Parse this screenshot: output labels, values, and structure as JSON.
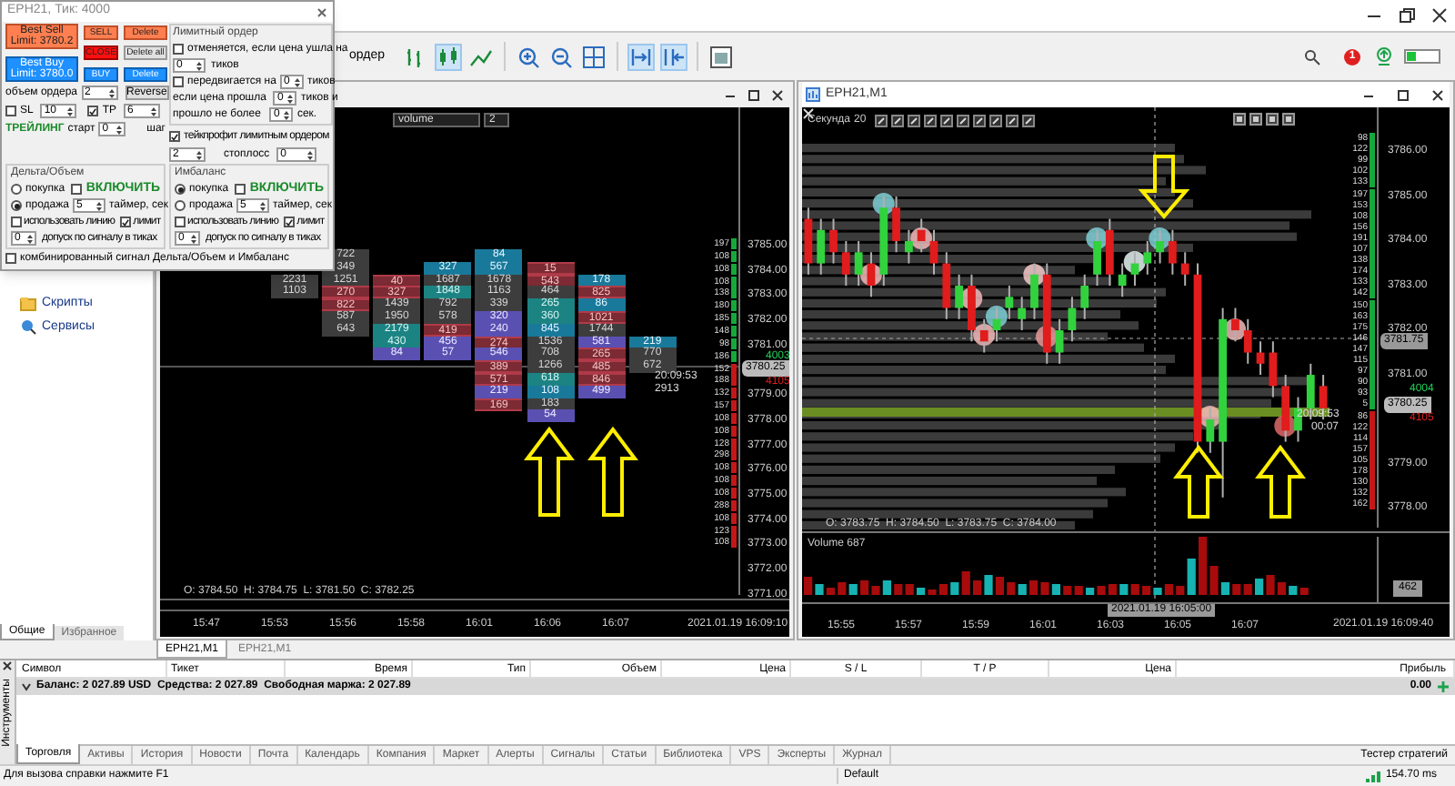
{
  "toolbar": {
    "partial_label": "ордер",
    "notification": "1"
  },
  "dialog": {
    "title": "EPH21, Тик: 4000",
    "big_buttons": [
      {
        "lines": [
          "Best Sell",
          "Limit: 3780.2"
        ],
        "kind": "sell"
      },
      {
        "lines": [
          "Best Buy",
          "Limit: 3780.0"
        ],
        "kind": "buy"
      }
    ],
    "small_buttons": [
      {
        "label": "SELL",
        "kind": "sell"
      },
      {
        "label": "Delete",
        "kind": "sell"
      },
      {
        "label": "CLOSE",
        "kind": "close"
      },
      {
        "label": "Delete all",
        "kind": "plain"
      },
      {
        "label": "BUY",
        "kind": "buy"
      },
      {
        "label": "Delete",
        "kind": "buy"
      }
    ],
    "volume": {
      "label": "объем ордера",
      "value": "2"
    },
    "reverse": "Reverse",
    "sl": {
      "label": "SL",
      "checked": false,
      "value": "10"
    },
    "tp": {
      "label": "TP",
      "checked": true,
      "value": "6"
    },
    "trailing": {
      "title": "ТРЕЙЛИНГ",
      "start_label": "старт",
      "start": "0",
      "step_label": "шаг",
      "step": "2",
      "stop_label": "стоплосс",
      "stop": "0"
    },
    "limit_order": {
      "title": "Лимитный ордер",
      "cancel": {
        "checked": false,
        "label": "отменяется, если цена ушла на",
        "value": "0",
        "unit": "тиков"
      },
      "move": {
        "checked": false,
        "label": "передвигается на",
        "value": "0",
        "unit": "тиков"
      },
      "if_passed": {
        "label": "если цена прошла",
        "value": "0",
        "unit": "тиков и"
      },
      "elapsed": {
        "label": "прошло не более",
        "value": "0",
        "unit": "сек."
      },
      "take_profit": {
        "checked": true,
        "label": "тейкпрофит лимитным ордером"
      }
    },
    "groups": [
      {
        "title": "Дельта/Объем",
        "buy": {
          "label": "покупка",
          "selected": false
        },
        "sell": {
          "label": "продажа",
          "selected": true
        },
        "enable": {
          "label": "ВКЛЮЧИТЬ",
          "checked": false
        },
        "timer": {
          "value": "5",
          "label": "таймер, сек"
        },
        "use_line": {
          "label": "использовать линию",
          "checked": false
        },
        "limit": {
          "label": "лимит",
          "checked": true
        },
        "tolerance": {
          "value": "0",
          "label": "допуск по сигналу в тиках"
        }
      },
      {
        "title": "Имбаланс",
        "buy": {
          "label": "покупка",
          "selected": true
        },
        "sell": {
          "label": "продажа",
          "selected": false
        },
        "enable": {
          "label": "ВКЛЮЧИТЬ",
          "checked": false
        },
        "timer": {
          "value": "5",
          "label": "таймер, сек"
        },
        "use_line": {
          "label": "использовать линию",
          "checked": false
        },
        "limit": {
          "label": "лимит",
          "checked": true
        },
        "tolerance": {
          "value": "0",
          "label": "допуск по сигналу в тиках"
        }
      }
    ],
    "combined": {
      "label": "комбинированный сигнал Дельта/Объем и Имбаланс",
      "checked": false
    }
  },
  "navigator": {
    "items": [
      "Скрипты",
      "Сервисы"
    ],
    "tabs": [
      {
        "label": "Общие",
        "selected": true
      },
      {
        "label": "Избранное",
        "selected": false
      }
    ]
  },
  "left_chart": {
    "toolbar": {
      "indicator": "volume",
      "value": "2"
    },
    "clusters": [
      {
        "cells": [
          {
            "value": "2231",
            "kind": "plain"
          },
          {
            "value": "1103",
            "kind": "plain"
          }
        ]
      },
      {
        "cells": [
          {
            "value": "722",
            "kind": "plain"
          },
          {
            "value": "349",
            "kind": "plain"
          },
          {
            "value": "1251",
            "kind": "plain"
          },
          {
            "value": "270",
            "kind": "ask"
          },
          {
            "value": "822",
            "kind": "ask"
          },
          {
            "value": "587",
            "kind": "plain"
          },
          {
            "value": "643",
            "kind": "plain"
          }
        ]
      },
      {
        "cells": [
          {
            "value": "40",
            "kind": "ask"
          },
          {
            "value": "327",
            "kind": "ask"
          },
          {
            "value": "1439",
            "kind": "plain"
          },
          {
            "value": "1950",
            "kind": "plain"
          },
          {
            "value": "2179",
            "kind": "bid"
          },
          {
            "value": "430",
            "kind": "bid"
          },
          {
            "value": "84",
            "kind": "low"
          }
        ]
      },
      {
        "cells": [
          {
            "value": "327",
            "kind": "max"
          },
          {
            "value": "1687",
            "kind": "plain"
          },
          {
            "value": "1848",
            "kind": "bid"
          },
          {
            "value": "792",
            "kind": "plain"
          },
          {
            "value": "578",
            "kind": "plain"
          },
          {
            "value": "419",
            "kind": "ask"
          },
          {
            "value": "456",
            "kind": "low"
          },
          {
            "value": "57",
            "kind": "low"
          }
        ]
      },
      {
        "cells": [
          {
            "value": "84",
            "kind": "max"
          },
          {
            "value": "567",
            "kind": "max"
          },
          {
            "value": "1678",
            "kind": "plain"
          },
          {
            "value": "1163",
            "kind": "plain"
          },
          {
            "value": "339",
            "kind": "plain"
          },
          {
            "value": "320",
            "kind": "low"
          },
          {
            "value": "240",
            "kind": "low"
          },
          {
            "value": "274",
            "kind": "ask"
          },
          {
            "value": "546",
            "kind": "low"
          },
          {
            "value": "389",
            "kind": "ask"
          },
          {
            "value": "571",
            "kind": "ask"
          },
          {
            "value": "219",
            "kind": "low"
          },
          {
            "value": "169",
            "kind": "ask"
          }
        ]
      },
      {
        "cells": [
          {
            "value": "15",
            "kind": "ask"
          },
          {
            "value": "543",
            "kind": "ask"
          },
          {
            "value": "464",
            "kind": "plain"
          },
          {
            "value": "265",
            "kind": "bid"
          },
          {
            "value": "360",
            "kind": "bid"
          },
          {
            "value": "845",
            "kind": "max"
          },
          {
            "value": "1536",
            "kind": "plain"
          },
          {
            "value": "708",
            "kind": "plain"
          },
          {
            "value": "1266",
            "kind": "plain"
          },
          {
            "value": "618",
            "kind": "bid"
          },
          {
            "value": "108",
            "kind": "max"
          },
          {
            "value": "183",
            "kind": "plain"
          },
          {
            "value": "54",
            "kind": "low"
          }
        ]
      },
      {
        "cells": [
          {
            "value": "178",
            "kind": "max"
          },
          {
            "value": "825",
            "kind": "ask"
          },
          {
            "value": "86",
            "kind": "max"
          },
          {
            "value": "1021",
            "kind": "ask"
          },
          {
            "value": "1744",
            "kind": "plain"
          },
          {
            "value": "581",
            "kind": "low"
          },
          {
            "value": "265",
            "kind": "ask"
          },
          {
            "value": "485",
            "kind": "ask"
          },
          {
            "value": "846",
            "kind": "ask"
          },
          {
            "value": "499",
            "kind": "low"
          }
        ]
      },
      {
        "cells": [
          {
            "value": "219",
            "kind": "max"
          },
          {
            "value": "770",
            "kind": "plain"
          },
          {
            "value": "672",
            "kind": "plain"
          }
        ]
      }
    ],
    "ladder": [
      {
        "value": "197",
        "color": "#16a83a"
      },
      {
        "value": "108",
        "color": "#16a83a"
      },
      {
        "value": "108",
        "color": "#16a83a"
      },
      {
        "value": "108",
        "color": "#16a83a"
      },
      {
        "value": "138",
        "color": "#16a83a"
      },
      {
        "value": "180",
        "color": "#16a83a"
      },
      {
        "value": "185",
        "color": "#16a83a"
      },
      {
        "value": "148",
        "color": "#16a83a"
      },
      {
        "value": "98",
        "color": "#16a83a"
      },
      {
        "value": "186",
        "color": "#16a83a"
      },
      {
        "value": "152",
        "color": "#c41818"
      },
      {
        "value": "188",
        "color": "#c41818"
      },
      {
        "value": "132",
        "color": "#c41818"
      },
      {
        "value": "157",
        "color": "#c41818"
      },
      {
        "value": "108",
        "color": "#c41818"
      },
      {
        "value": "108",
        "color": "#c41818"
      },
      {
        "value": "128",
        "color": "#c41818"
      },
      {
        "value": "298",
        "color": "#c41818"
      },
      {
        "value": "108",
        "color": "#c41818"
      },
      {
        "value": "108",
        "color": "#c41818"
      },
      {
        "value": "108",
        "color": "#c41818"
      },
      {
        "value": "288",
        "color": "#c41818"
      },
      {
        "value": "108",
        "color": "#c41818"
      },
      {
        "value": "123",
        "color": "#c41818"
      },
      {
        "value": "108",
        "color": "#c41818"
      }
    ],
    "price_labels": [
      "3785.00",
      "3784.00",
      "3783.00",
      "3782.00",
      "3781.00",
      "3779.00",
      "3778.00",
      "3777.00",
      "3776.00",
      "3775.00",
      "3774.00",
      "3773.00",
      "3772.00",
      "3771.00"
    ],
    "price_tag": "3780.25",
    "bid": "4003",
    "ask": "4105",
    "timer": "20:09:53",
    "timer_value": "2913",
    "ohlc": "O: 3784.50  H: 3784.75  L: 3781.50  C: 3782.25",
    "times": [
      "15:47",
      "15:53",
      "15:56",
      "15:58",
      "16:01",
      "16:06",
      "16:07"
    ],
    "date": "2021.01.19 16:09:10"
  },
  "right_chart": {
    "title": "EPH21,M1",
    "toolbar": {
      "period_label": "Секунда",
      "period": "20"
    },
    "chart_data": {
      "type": "candlestick",
      "categories": [
        null,
        null,
        null,
        null,
        null,
        null,
        null,
        null,
        null,
        null,
        null,
        null,
        null,
        null,
        null,
        null,
        null,
        null,
        null,
        null,
        null,
        null,
        null,
        null,
        null,
        null,
        null,
        null,
        null,
        null,
        null,
        null,
        null,
        null,
        null,
        null,
        null,
        null,
        null,
        null,
        null,
        null
      ],
      "ylim": [
        3775.9,
        3787
      ],
      "yticks": [
        {
          "value": 3786,
          "label": "3786.00"
        },
        {
          "value": 3785,
          "label": "3785.00"
        },
        {
          "value": 3784,
          "label": "3784.00"
        },
        {
          "value": 3783,
          "label": "3783.00"
        },
        {
          "value": 3782,
          "label": "3782.00"
        },
        {
          "value": 3781,
          "label": "3781.00"
        },
        {
          "value": 3779,
          "label": "3779.00"
        },
        {
          "value": 3778,
          "label": "3778.00"
        }
      ],
      "ohlc": [
        [
          3784.5,
          3784.75,
          3783.25,
          3783.5
        ],
        [
          3783.5,
          3784.5,
          3783.25,
          3784.25
        ],
        [
          3784.25,
          3784.5,
          3783.5,
          3783.75
        ],
        [
          3783.75,
          3784,
          3783,
          3783.25
        ],
        [
          3783.25,
          3784,
          3783,
          3783.75
        ],
        [
          3783.5,
          3783.75,
          3782.75,
          3783
        ],
        [
          3783.25,
          3785,
          3783,
          3784.75
        ],
        [
          3784.75,
          3785,
          3783.75,
          3784
        ],
        [
          3783.75,
          3784.25,
          3783.5,
          3784
        ],
        [
          3784.25,
          3784.5,
          3783.75,
          3784
        ],
        [
          3784,
          3784.25,
          3783.25,
          3783.5
        ],
        [
          3783.5,
          3783.75,
          3782.25,
          3782.5
        ],
        [
          3782.5,
          3783.25,
          3782.25,
          3783
        ],
        [
          3783,
          3783.25,
          3781.75,
          3782
        ],
        [
          3782,
          3782.25,
          3781.5,
          3781.75
        ],
        [
          3782,
          3782.5,
          3781.75,
          3782.25
        ],
        [
          3782.5,
          3783,
          3782.25,
          3782.75
        ],
        [
          3782.25,
          3782.75,
          3782,
          3782.5
        ],
        [
          3782.5,
          3783.5,
          3782.25,
          3783.25
        ],
        [
          3783.25,
          3783.5,
          3781.25,
          3781.5
        ],
        [
          3781.5,
          3782.25,
          3781.25,
          3782
        ],
        [
          3782,
          3782.75,
          3781.75,
          3782.5
        ],
        [
          3782.5,
          3783.25,
          3782.25,
          3783
        ],
        [
          3783.25,
          3784.25,
          3783,
          3784
        ],
        [
          3784.25,
          3784.5,
          3783,
          3783.25
        ],
        [
          3783,
          3783.5,
          3782.75,
          3783.25
        ],
        [
          3783.25,
          3783.75,
          3783,
          3783.5
        ],
        [
          3783.5,
          3784,
          3783.25,
          3783.75
        ],
        [
          3783.75,
          3784.25,
          3783.5,
          3784
        ],
        [
          3784,
          3784.25,
          3783.25,
          3783.5
        ],
        [
          3783.5,
          3783.75,
          3783,
          3783.25
        ],
        [
          3783.25,
          3783.5,
          3779.25,
          3779.5
        ],
        [
          3779.5,
          3780.25,
          3779.25,
          3780
        ],
        [
          3779.5,
          3782.5,
          3778.25,
          3782.25
        ],
        [
          3782.25,
          3782.5,
          3781.75,
          3782
        ],
        [
          3782,
          3782.25,
          3781.25,
          3781.5
        ],
        [
          3781.5,
          3781.75,
          3781,
          3781.25
        ],
        [
          3781.5,
          3781.75,
          3780.5,
          3780.75
        ],
        [
          3780.75,
          3781,
          3779.5,
          3779.75
        ],
        [
          3779.75,
          3780.5,
          3779.5,
          3780.25
        ],
        [
          3780.25,
          3781.25,
          3780,
          3781
        ],
        [
          3780.75,
          3781,
          3780,
          3780.25
        ]
      ]
    },
    "ladder": [
      {
        "value": "98",
        "color": "#16a83a"
      },
      {
        "value": "122",
        "color": "#16a83a"
      },
      {
        "value": "99",
        "color": "#16a83a"
      },
      {
        "value": "102",
        "color": "#16a83a"
      },
      {
        "value": "133",
        "color": "#16a83a"
      },
      {
        "value": "197",
        "color": "#16a83a"
      },
      {
        "value": "153",
        "color": "#16a83a"
      },
      {
        "value": "108",
        "color": "#16a83a"
      },
      {
        "value": "156",
        "color": "#16a83a"
      },
      {
        "value": "191",
        "color": "#16a83a"
      },
      {
        "value": "107",
        "color": "#16a83a"
      },
      {
        "value": "138",
        "color": "#16a83a"
      },
      {
        "value": "174",
        "color": "#16a83a"
      },
      {
        "value": "133",
        "color": "#16a83a"
      },
      {
        "value": "142",
        "color": "#16a83a"
      },
      {
        "value": "150",
        "color": "#16a83a"
      },
      {
        "value": "163",
        "color": "#16a83a"
      },
      {
        "value": "175",
        "color": "#16a83a"
      },
      {
        "value": "146",
        "color": "#16a83a"
      },
      {
        "value": "147",
        "color": "#16a83a"
      },
      {
        "value": "115",
        "color": "#16a83a"
      },
      {
        "value": "97",
        "color": "#16a83a"
      },
      {
        "value": "90",
        "color": "#16a83a"
      },
      {
        "value": "93",
        "color": "#16a83a"
      },
      {
        "value": "5",
        "color": "#16a83a"
      },
      {
        "value": "86",
        "color": "#c41818"
      },
      {
        "value": "122",
        "color": "#c41818"
      },
      {
        "value": "114",
        "color": "#c41818"
      },
      {
        "value": "157",
        "color": "#c41818"
      },
      {
        "value": "105",
        "color": "#c41818"
      },
      {
        "value": "178",
        "color": "#c41818"
      },
      {
        "value": "130",
        "color": "#c41818"
      },
      {
        "value": "132",
        "color": "#c41818"
      },
      {
        "value": "162",
        "color": "#c41818"
      }
    ],
    "crosshair_price": "3781.75",
    "price_tag": "3780.25",
    "bid": "4004",
    "ask": "4105",
    "timer": "20:09:53",
    "timer_value": "00:07",
    "ohlc": "O: 3783.75  H: 3784.50  L: 3783.75  C: 3784.00",
    "volume_label": "Volume 687",
    "volume_tag": "462",
    "crosshair_time": "2021.01.19 16:05:00",
    "times": [
      "15:55",
      "15:57",
      "15:59",
      "16:01",
      "16:03",
      "16:05",
      "16:07"
    ],
    "date": "2021.01.19 16:09:40"
  },
  "chart_tabs": [
    {
      "label": "EPH21,M1",
      "selected": true
    },
    {
      "label": "EPH21,M1",
      "selected": false
    }
  ],
  "terminal": {
    "side_label": "Инструменты",
    "columns": [
      "Символ",
      "Тикет",
      "Время",
      "Тип",
      "Объем",
      "Цена",
      "S / L",
      "T / P",
      "Цена",
      "Прибыль"
    ],
    "balance": "Баланс: 2 027.89 USD  Средства: 2 027.89  Свободная маржа: 2 027.89",
    "profit": "0.00",
    "tabs": [
      {
        "label": "Торговля",
        "selected": true
      },
      {
        "label": "Активы",
        "selected": false
      },
      {
        "label": "История",
        "selected": false
      },
      {
        "label": "Новости",
        "selected": false
      },
      {
        "label": "Почта",
        "selected": false
      },
      {
        "label": "Календарь",
        "selected": false
      },
      {
        "label": "Компания",
        "selected": false
      },
      {
        "label": "Маркет",
        "selected": false
      },
      {
        "label": "Алерты",
        "selected": false
      },
      {
        "label": "Сигналы",
        "selected": false
      },
      {
        "label": "Статьи",
        "selected": false
      },
      {
        "label": "Библиотека",
        "selected": false
      },
      {
        "label": "VPS",
        "selected": false
      },
      {
        "label": "Эксперты",
        "selected": false
      },
      {
        "label": "Журнал",
        "selected": false
      }
    ],
    "tester": "Тестер стратегий"
  },
  "status_bar": {
    "help": "Для вызова справки нажмите F1",
    "profile": "Default",
    "ping": "154.70 ms"
  }
}
